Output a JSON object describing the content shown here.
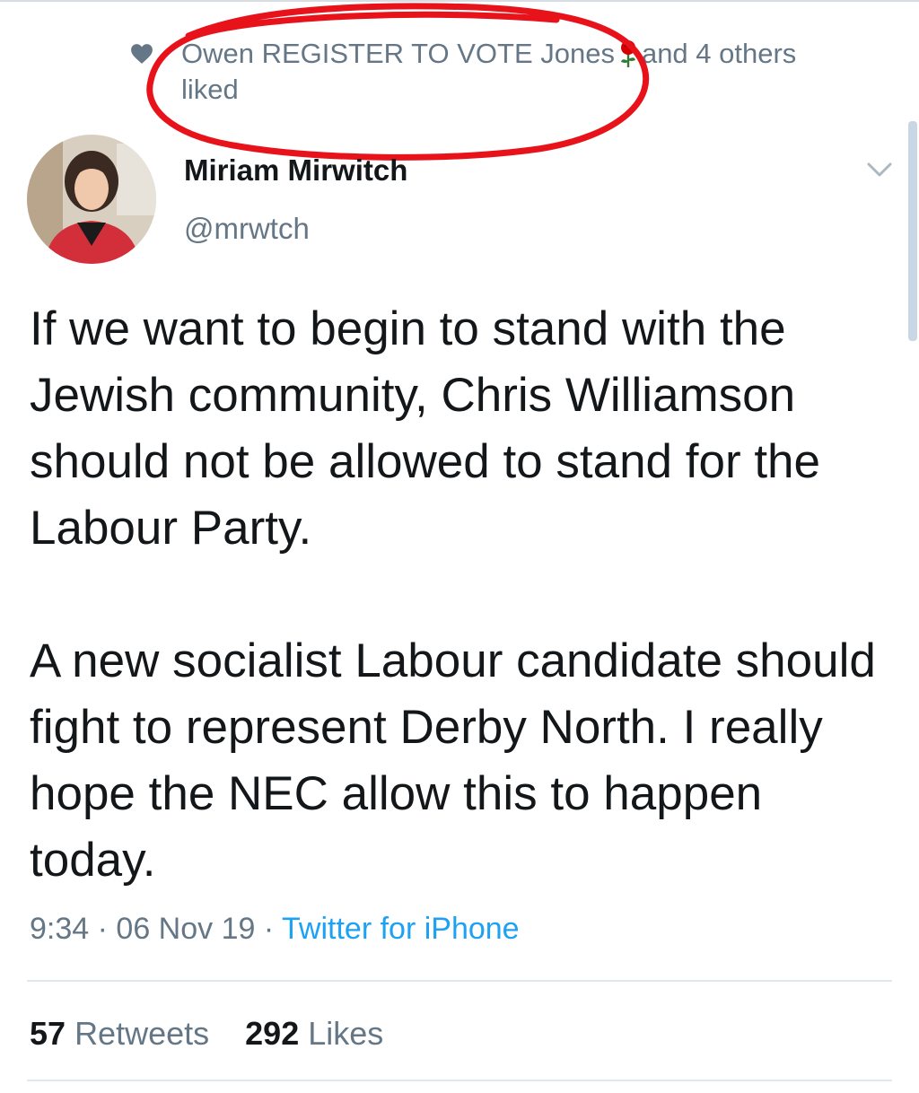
{
  "colors": {
    "text": "#14171a",
    "secondary": "#657786",
    "link": "#1da1f2",
    "annotation": "#e8131a"
  },
  "context": {
    "icon": "heart-icon",
    "liker_name": "Owen REGISTER TO VOTE Jones",
    "liker_emoji": "rose-icon",
    "rest": "and 4 others",
    "action": "liked"
  },
  "author": {
    "name": "Miriam Mirwitch",
    "handle": "@mrwtch",
    "avatar_icon": "avatar-photo"
  },
  "tweet": {
    "paragraphs": [
      "If we want to begin to stand with the Jewish community, Chris Williamson should not be allowed to stand for the Labour Party.",
      "A new socialist Labour candidate should fight to represent Derby North. I really hope the NEC allow this to happen today."
    ]
  },
  "meta": {
    "time": "9:34",
    "sep1": " · ",
    "date": "06 Nov 19",
    "sep2": " · ",
    "source": "Twitter for iPhone"
  },
  "stats": {
    "retweets_count": "57",
    "retweets_label": "Retweets",
    "likes_count": "292",
    "likes_label": "Likes"
  }
}
